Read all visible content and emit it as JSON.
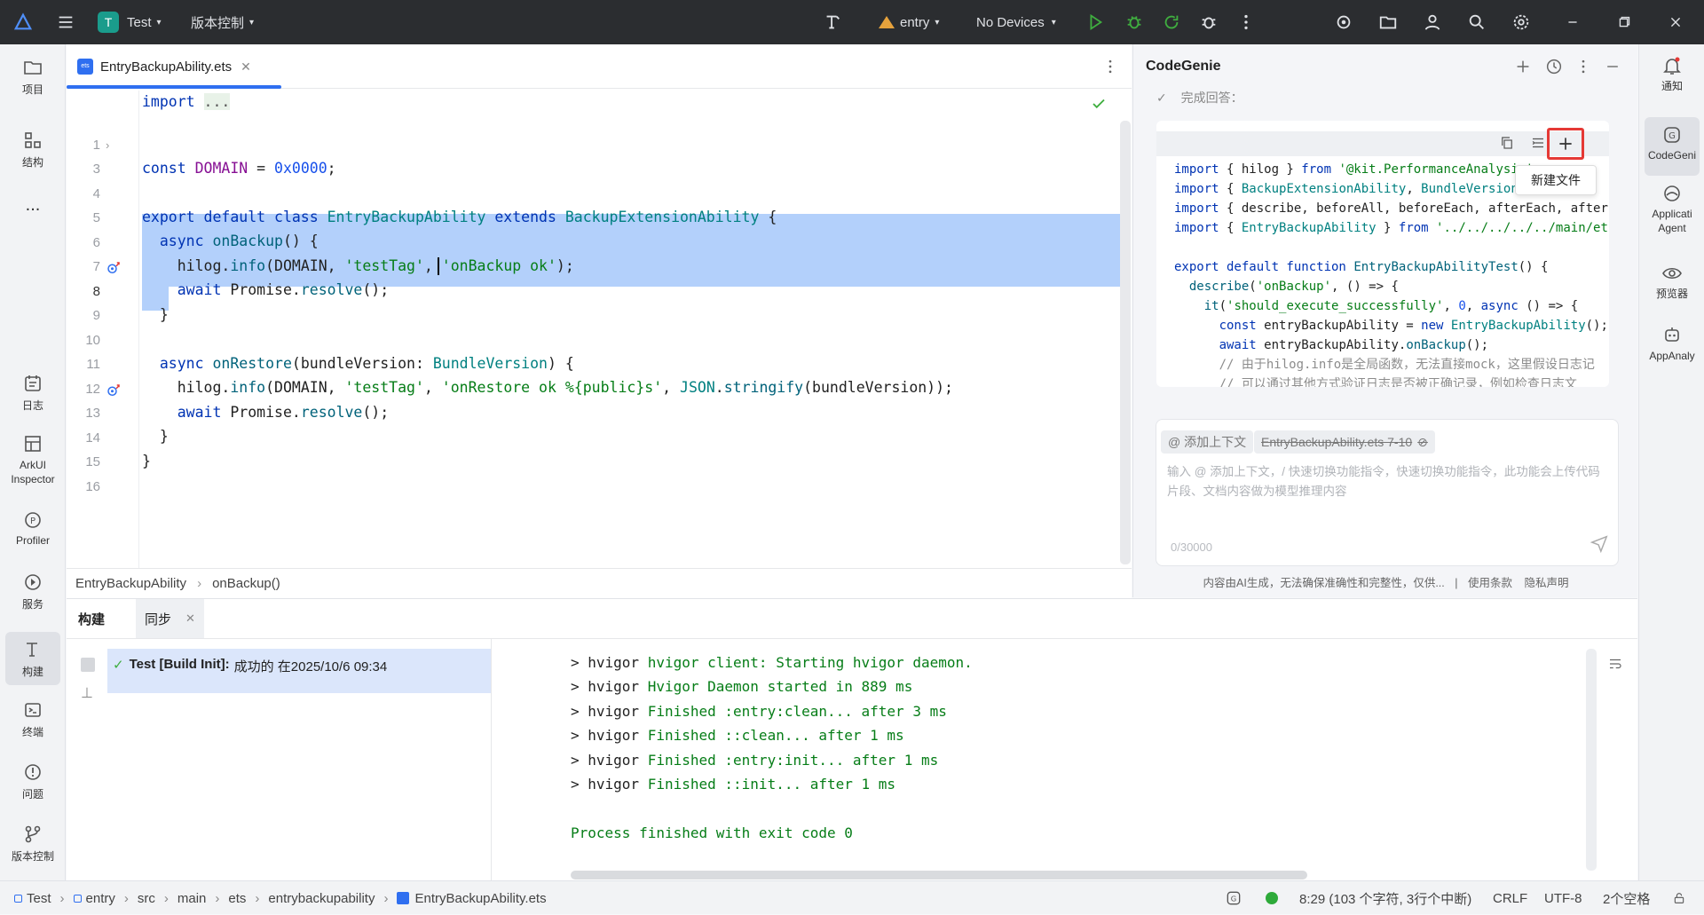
{
  "titlebar": {
    "project_letter": "T",
    "project_name": "Test",
    "vcs": "版本控制",
    "module": "entry",
    "device": "No Devices"
  },
  "left_toolbar": {
    "items": [
      {
        "label": "项目",
        "icon": "folder-icon"
      },
      {
        "label": "结构",
        "icon": "structure-icon"
      },
      {
        "label": "...",
        "icon": "more-icon"
      },
      {
        "label": "日志",
        "icon": "log-icon"
      },
      {
        "label": "ArkUI Inspector",
        "icon": "inspector-icon"
      },
      {
        "label": "Profiler",
        "icon": "profiler-icon"
      },
      {
        "label": "服务",
        "icon": "service-icon"
      },
      {
        "label": "构建",
        "icon": "build-icon"
      },
      {
        "label": "终端",
        "icon": "terminal-icon"
      },
      {
        "label": "问题",
        "icon": "problem-icon"
      },
      {
        "label": "版本控制",
        "icon": "vcs-icon"
      }
    ]
  },
  "right_toolbar": {
    "items": [
      {
        "label": "通知",
        "icon": "bell-icon"
      },
      {
        "label": "CodeGeni",
        "icon": "codegenie-icon"
      },
      {
        "label": "Applicati Agent",
        "icon": "agent-icon"
      },
      {
        "label": "预览器",
        "icon": "eye-icon"
      },
      {
        "label": "AppAnaly",
        "icon": "analyzer-icon"
      }
    ]
  },
  "editor": {
    "tab_name": "EntryBackupAbility.ets",
    "line_numbers": [
      "1",
      "3",
      "4",
      "5",
      "6",
      "7",
      "8",
      "9",
      "10",
      "11",
      "12",
      "13",
      "14",
      "15",
      "16"
    ],
    "breadcrumb": [
      "EntryBackupAbility",
      "onBackup()"
    ]
  },
  "codegenie": {
    "title": "CodeGenie",
    "status_text": "完成回答：",
    "tooltip": "新建文件",
    "chip_context": "@ 添加上下文",
    "chip_file": "EntryBackupAbility.ets 7-10",
    "placeholder": "输入 @ 添加上下文，/ 快速切换功能指令，快速切换功能指令，此功能会上传代码片段、文档内容做为模型推理内容",
    "counter": "0/30000",
    "disclaimer": "内容由AI生成，无法确保准确性和完整性，仅供...",
    "terms": "使用条款",
    "privacy": "隐私声明"
  },
  "bottom": {
    "tab_build": "构建",
    "tab_sync": "同步",
    "build_item_bold": "Test [Build Init]:",
    "build_item_rest": "成功的 在2025/10/6 09:34",
    "exit_line": "Process finished with exit code 0"
  },
  "statusbar": {
    "path": [
      "Test",
      "entry",
      "src",
      "main",
      "ets",
      "entrybackupability",
      "EntryBackupAbility.ets"
    ],
    "position": "8:29 (103 个字符, 3行个中断)",
    "line_ending": "CRLF",
    "encoding": "UTF-8",
    "indent": "2个空格"
  },
  "colors": {
    "accent": "#2f6ff0",
    "selection": "#b3d0fb",
    "run_green": "#3fae3f",
    "highlight_red": "#e53935"
  }
}
